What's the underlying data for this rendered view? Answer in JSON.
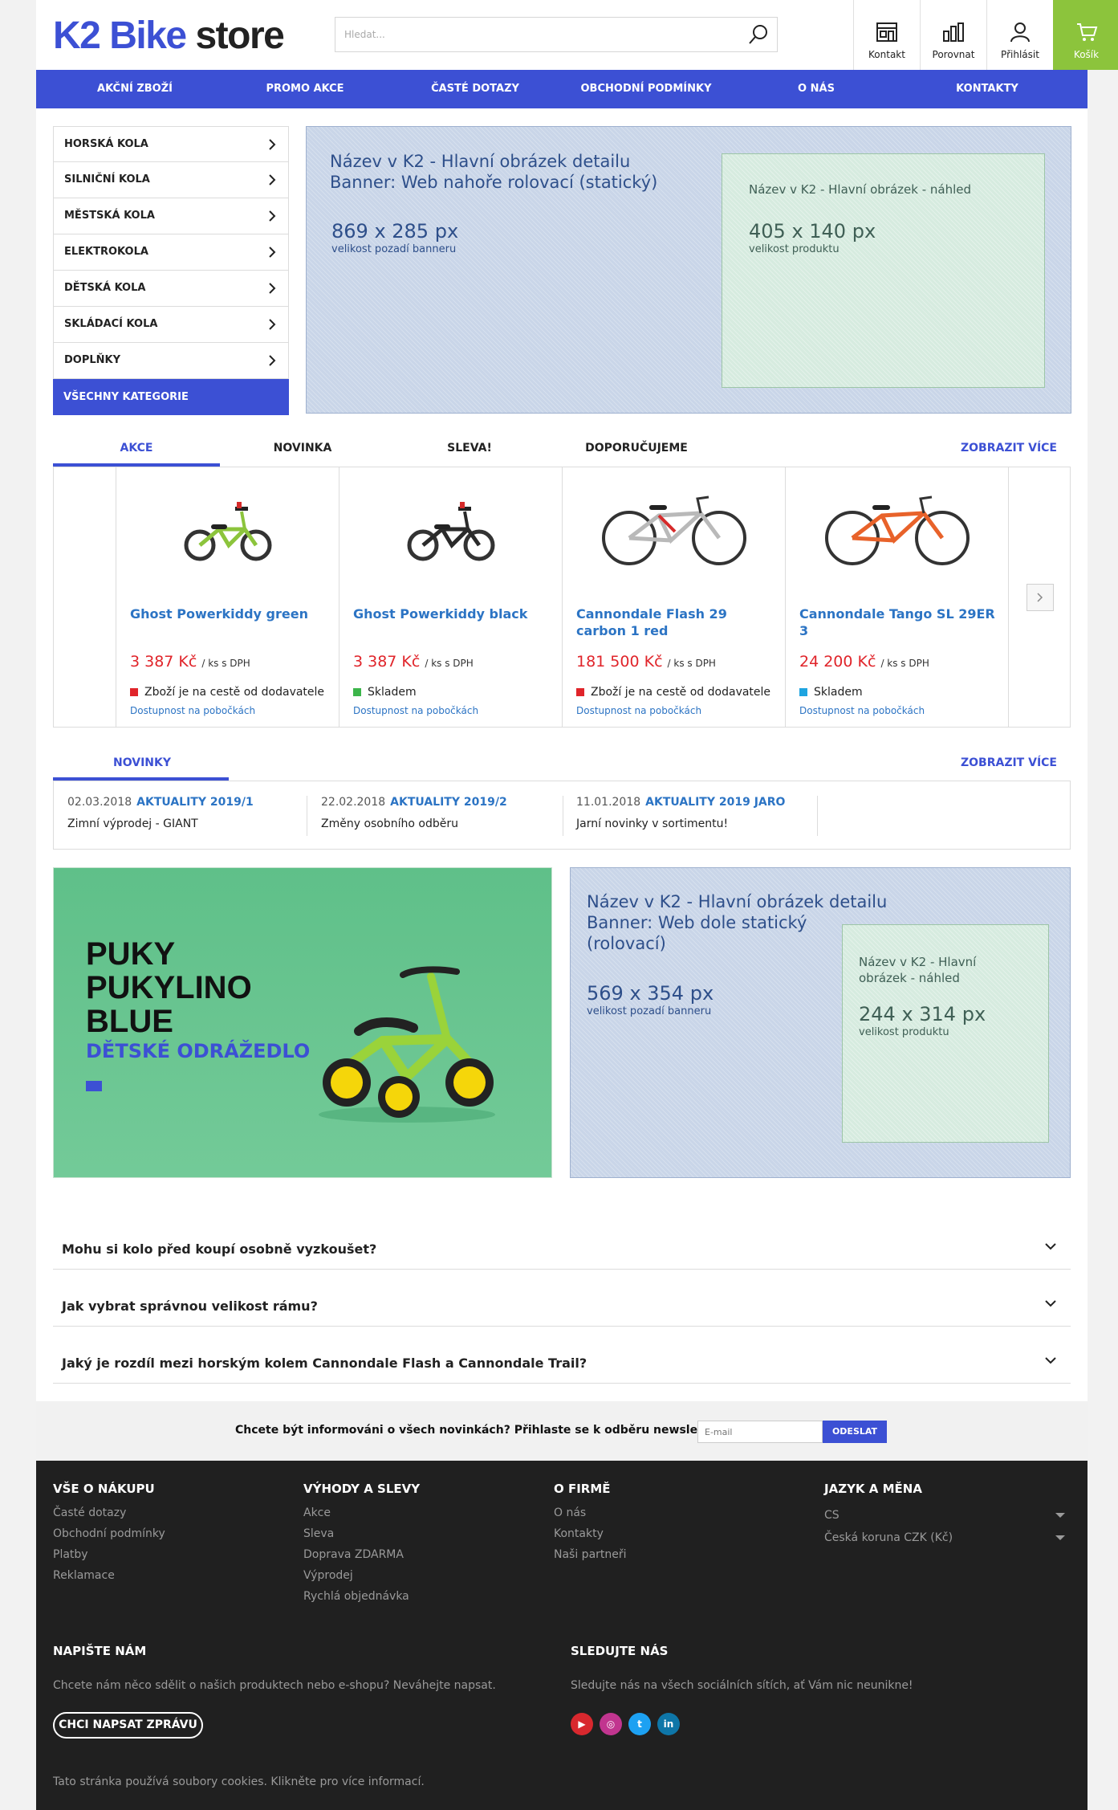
{
  "logo": {
    "brand": "K2 Bike",
    "suffix": "store"
  },
  "search": {
    "placeholder": "Hledat..."
  },
  "header_buttons": [
    {
      "label": "Kontakt",
      "icon": "store-icon"
    },
    {
      "label": "Porovnat",
      "icon": "compare-chart-icon"
    },
    {
      "label": "Přihlásit",
      "icon": "user-icon"
    },
    {
      "label": "Košík",
      "icon": "cart-icon"
    }
  ],
  "nav": [
    "AKČNÍ ZBOŽÍ",
    "PROMO AKCE",
    "ČASTÉ DOTAZY",
    "OBCHODNÍ PODMÍNKY",
    "O NÁS",
    "KONTAKTY"
  ],
  "sidebar": {
    "items": [
      "HORSKÁ KOLA",
      "SILNIČNÍ KOLA",
      "MĚSTSKÁ KOLA",
      "ELEKTROKOLA",
      "DĚTSKÁ KOLA",
      "SKLÁDACÍ KOLA",
      "DOPLŇKY"
    ],
    "all": "VŠECHNY KATEGORIE"
  },
  "top_banner": {
    "title_line1": "Název v K2 - Hlavní obrázek detailu",
    "title_line2": "Banner: Web nahoře rolovací (statický)",
    "size": "869 x 285 px",
    "size_label": "velikost pozadí banneru",
    "inner_title": "Název v K2 - Hlavní obrázek - náhled",
    "inner_size": "405 x 140 px",
    "inner_label": "velikost produktu"
  },
  "product_tabs": {
    "tabs": [
      "AKCE",
      "NOVINKA",
      "SLEVA!",
      "DOPORUČUJEME"
    ],
    "more": "ZOBRAZIT VÍCE"
  },
  "products": [
    {
      "name": "Ghost Powerkiddy green",
      "price": "3 387 Kč",
      "unit": "/ ks s DPH",
      "stock": "Zboží je na cestě od dodavatele",
      "stock_color": "#e0242a",
      "avail": "Dostupnost na pobočkách"
    },
    {
      "name": "Ghost Powerkiddy black",
      "price": "3 387 Kč",
      "unit": "/ ks s DPH",
      "stock": "Skladem",
      "stock_color": "#3cb54a",
      "avail": "Dostupnost na pobočkách"
    },
    {
      "name": "Cannondale Flash 29 carbon 1 red",
      "price": "181 500 Kč",
      "unit": "/ ks s DPH",
      "stock": "Zboží je na cestě od dodavatele",
      "stock_color": "#e0242a",
      "avail": "Dostupnost na pobočkách"
    },
    {
      "name": "Cannondale Tango SL 29ER 3",
      "price": "24 200 Kč",
      "unit": "/ ks s DPH",
      "stock": "Skladem",
      "stock_color": "#1ea4e0",
      "avail": "Dostupnost na pobočkách"
    }
  ],
  "news_tabs": {
    "tab": "NOVINKY",
    "more": "ZOBRAZIT VÍCE"
  },
  "news": [
    {
      "date": "02.03.2018",
      "category": "AKTUALITY 2019/1",
      "text": "Zimní výprodej - GIANT"
    },
    {
      "date": "22.02.2018",
      "category": "AKTUALITY 2019/2",
      "text": "Změny osobního odběru"
    },
    {
      "date": "11.01.2018",
      "category": "AKTUALITY 2019 JARO",
      "text": "Jarní novinky v sortimentu!"
    }
  ],
  "puky_banner": {
    "line1": "PUKY",
    "line2": "PUKYLINO",
    "line3": "BLUE",
    "subtitle": "DĚTSKÉ ODRÁŽEDLO"
  },
  "bottom_banner": {
    "title_line1": "Název v K2 - Hlavní obrázek detailu",
    "title_line2": "Banner: Web dole statický",
    "title_line3": "(rolovací)",
    "size": "569 x 354 px",
    "size_label": "velikost pozadí banneru",
    "inner_title_line1": "Název v K2 - Hlavní",
    "inner_title_line2": "obrázek - náhled",
    "inner_size": "244 x 314 px",
    "inner_label": "velikost produktu"
  },
  "faq": [
    "Mohu si kolo před koupí osobně vyzkoušet?",
    "Jak vybrat správnou velikost rámu?",
    "Jaký je rozdíl mezi horským kolem Cannondale Flash a Cannondale Trail?"
  ],
  "newsletter": {
    "text": "Chcete být informováni o všech novinkách? Přihlaste se k odběru newsletteru.",
    "placeholder": "E-mail",
    "button": "ODESLAT"
  },
  "footer": {
    "columns": [
      {
        "title": "VŠE O NÁKUPU",
        "links": [
          "Časté dotazy",
          "Obchodní podmínky",
          "Platby",
          "Reklamace"
        ]
      },
      {
        "title": "VÝHODY A SLEVY",
        "links": [
          "Akce",
          "Sleva",
          "Doprava ZDARMA",
          "Výprodej",
          "Rychlá objednávka"
        ]
      },
      {
        "title": "O FIRMĚ",
        "links": [
          "O nás",
          "Kontakty",
          "Naši partneři"
        ]
      }
    ],
    "lang": {
      "title": "JAZYK A MĚNA",
      "language": "CS",
      "currency": "Česká koruna CZK (Kč)"
    },
    "write": {
      "title": "NAPIŠTE NÁM",
      "text": "Chcete nám něco sdělit o našich produktech nebo e-shopu? Neváhejte napsat.",
      "button": "CHCI NAPSAT ZPRÁVU"
    },
    "follow": {
      "title": "SLEDUJTE NÁS",
      "text": "Sledujte nás na všech sociálních sítích, ať Vám nic neunikne!",
      "icons": [
        "youtube-icon",
        "instagram-icon",
        "twitter-icon",
        "linkedin-icon"
      ]
    },
    "cookie": "Tato stránka používá soubory cookies. Klikněte pro více informací."
  },
  "colors": {
    "accent": "#3c50d4",
    "cart": "#8cc43c",
    "price": "#e0242a",
    "link": "#2c74c4",
    "footer_bg": "#202020"
  }
}
